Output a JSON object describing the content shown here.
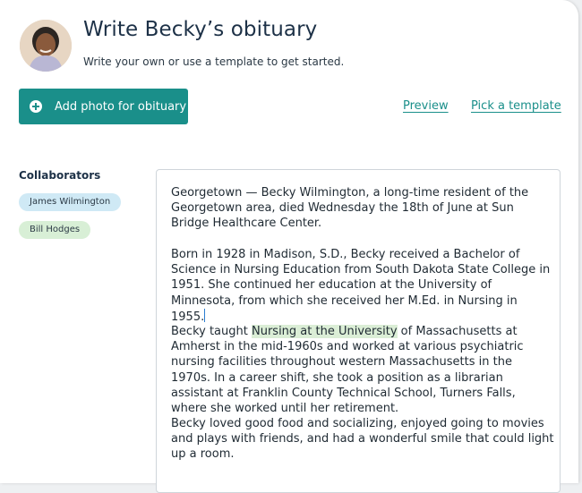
{
  "header": {
    "title": "Write Becky’s obituary",
    "subtitle": "Write your own or use a template to get started."
  },
  "actions": {
    "add_photo_label": "Add photo for obituary",
    "preview_label": "Preview",
    "pick_template_label": "Pick a template"
  },
  "collaborators": {
    "heading": "Collaborators",
    "people": [
      "James Wilmington",
      "Bill Hodges"
    ]
  },
  "editor": {
    "p1": "Georgetown — Becky Wilmington, a long-time resident of the Georgetown area, died Wednesday the 18th of June at Sun Bridge Healthcare Center.",
    "p2": "Born in 1928 in Madison, S.D., Becky received a Bachelor of Science in Nursing Education from South Dakota State College in 1951. She continued her education at the University of Minnesota, from which she received her M.Ed. in Nursing in 1955.",
    "p3_before": "Becky taught ",
    "p3_highlight": "Nursing at the University",
    "p3_after": " of Massachusetts at Amherst in the mid-1960s and worked at various psychiatric nursing facilities throughout western Massachusetts in the 1970s. In a career shift, she took a position as a librarian assistant at Franklin County Technical School, Turners Falls, where she worked until her retirement.",
    "p4": "Becky loved good food and socializing, enjoyed going to movies and plays with friends, and had a wonderful smile that could light up a room."
  },
  "colors": {
    "accent": "#1a8f8a",
    "title_text": "#1d3147",
    "chip_blue": "#cfe9f5",
    "chip_green": "#d8efd6",
    "highlight": "#dbeed6"
  }
}
